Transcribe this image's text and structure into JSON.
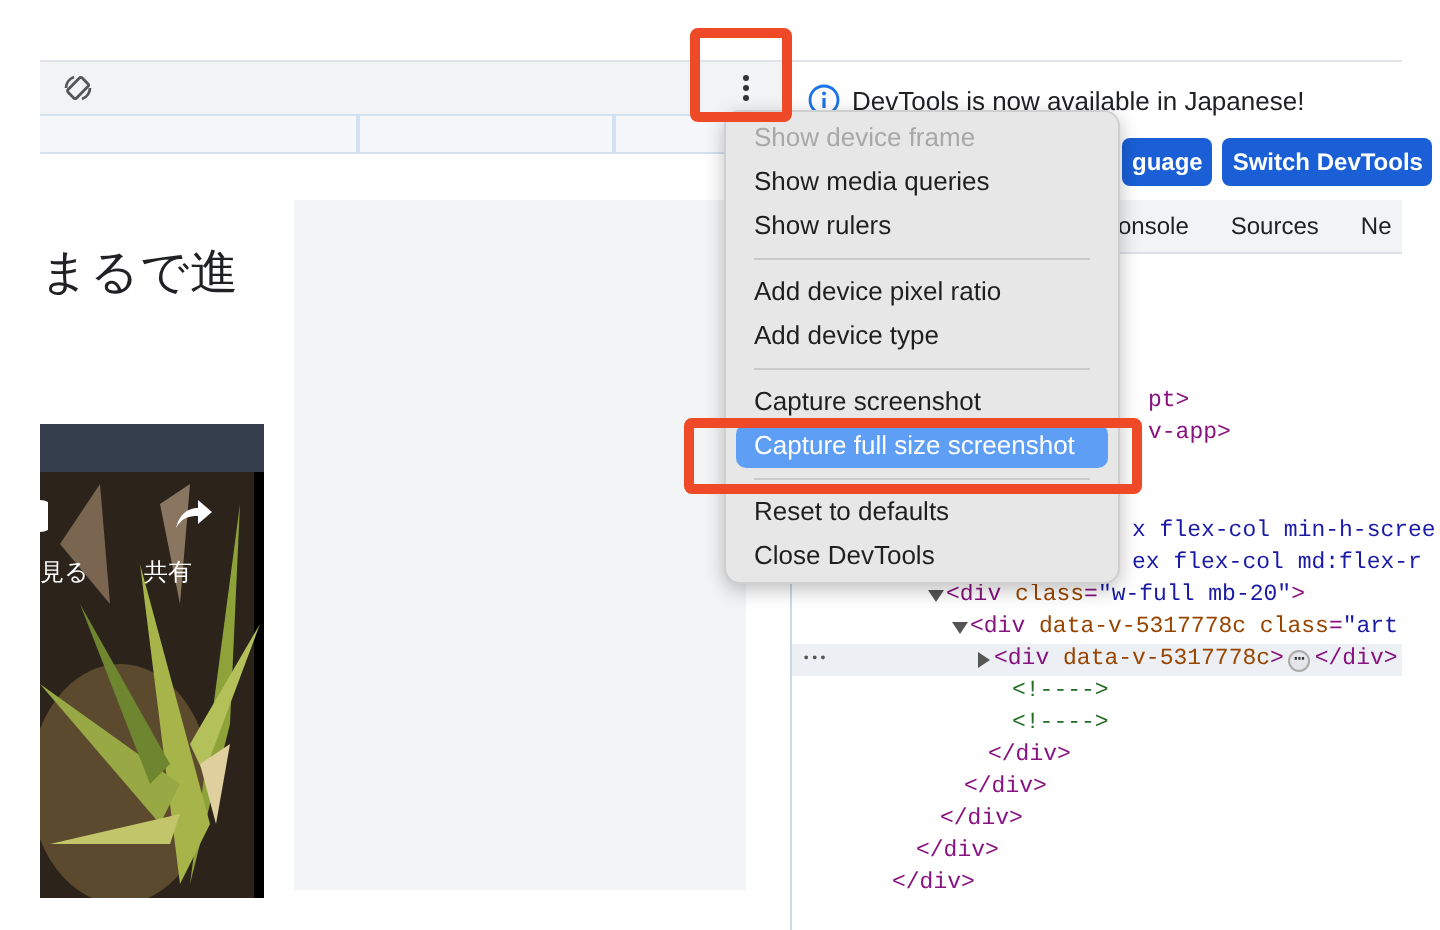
{
  "page": {
    "heading": "まるで進",
    "video": {
      "kind": "picture",
      "actions": [
        {
          "label": "見る"
        },
        {
          "label": "共有"
        }
      ]
    }
  },
  "devtools": {
    "notice": "DevTools is now available in Japanese!",
    "buttons": [
      "guage",
      "Switch DevTools"
    ],
    "tabs": [
      {
        "label": "onsole",
        "selected": false
      },
      {
        "label": "Sources",
        "selected": false
      },
      {
        "label": "Ne",
        "selected": false
      }
    ],
    "elements": [
      {
        "kind": "text",
        "highlighted": false,
        "tokens": [
          {
            "kind": "tag",
            "text": "pt>"
          }
        ]
      },
      {
        "kind": "text",
        "highlighted": false,
        "tokens": [
          {
            "kind": "tag",
            "text": "v-app>"
          }
        ]
      },
      {
        "kind": "text",
        "highlighted": false,
        "tokens": [
          {
            "kind": "value",
            "text": "x flex-col min-h-scree"
          }
        ]
      },
      {
        "kind": "text",
        "highlighted": false,
        "tokens": [
          {
            "kind": "value",
            "text": "ex flex-col md:flex-r"
          }
        ]
      },
      {
        "kind": "open",
        "highlighted": false,
        "tokens": [
          {
            "kind": "tag",
            "text": "<div"
          },
          {
            "kind": "attr",
            "text": " class"
          },
          {
            "kind": "tag",
            "text": "="
          },
          {
            "kind": "value",
            "text": "\"w-full mb-20\""
          },
          {
            "kind": "tag",
            "text": ">"
          }
        ]
      },
      {
        "kind": "open",
        "highlighted": false,
        "tokens": [
          {
            "kind": "tag",
            "text": "<div"
          },
          {
            "kind": "attr",
            "text": " data-v-5317778c"
          },
          {
            "kind": "attr",
            "text": " class"
          },
          {
            "kind": "tag",
            "text": "="
          },
          {
            "kind": "value",
            "text": "\"art"
          }
        ]
      },
      {
        "kind": "closed",
        "highlighted": true,
        "gutter": "•••",
        "tokens": [
          {
            "kind": "tag",
            "text": "<div"
          },
          {
            "kind": "attr",
            "text": " data-v-5317778c"
          },
          {
            "kind": "tag",
            "text": ">"
          },
          {
            "kind": "badge",
            "text": "⋯"
          },
          {
            "kind": "tag",
            "text": "</div>"
          }
        ]
      },
      {
        "kind": "text",
        "highlighted": false,
        "tokens": [
          {
            "kind": "comment",
            "text": "<!---->"
          }
        ]
      },
      {
        "kind": "text",
        "highlighted": false,
        "tokens": [
          {
            "kind": "comment",
            "text": "<!---->"
          }
        ]
      },
      {
        "kind": "text",
        "highlighted": false,
        "tokens": [
          {
            "kind": "tag",
            "text": "</div>"
          }
        ]
      },
      {
        "kind": "text",
        "highlighted": false,
        "tokens": [
          {
            "kind": "tag",
            "text": "</div>"
          }
        ]
      },
      {
        "kind": "text",
        "highlighted": false,
        "tokens": [
          {
            "kind": "tag",
            "text": "</div>"
          }
        ]
      },
      {
        "kind": "text",
        "highlighted": false,
        "tokens": [
          {
            "kind": "tag",
            "text": "</div>"
          }
        ]
      },
      {
        "kind": "text",
        "highlighted": false,
        "tokens": [
          {
            "kind": "tag",
            "text": "</div>"
          }
        ]
      }
    ]
  },
  "menu": [
    {
      "kind": "item",
      "label": "Show device frame",
      "disabled": true,
      "selected": false
    },
    {
      "kind": "item",
      "label": "Show media queries",
      "disabled": false,
      "selected": false
    },
    {
      "kind": "item",
      "label": "Show rulers",
      "disabled": false,
      "selected": false
    },
    {
      "kind": "separator"
    },
    {
      "kind": "item",
      "label": "Add device pixel ratio",
      "disabled": false,
      "selected": false
    },
    {
      "kind": "item",
      "label": "Add device type",
      "disabled": false,
      "selected": false
    },
    {
      "kind": "separator"
    },
    {
      "kind": "item",
      "label": "Capture screenshot",
      "disabled": false,
      "selected": false
    },
    {
      "kind": "item",
      "label": "Capture full size screenshot",
      "disabled": false,
      "selected": true
    },
    {
      "kind": "separator"
    },
    {
      "kind": "item",
      "label": "Reset to defaults",
      "disabled": false,
      "selected": false
    },
    {
      "kind": "item",
      "label": "Close DevTools",
      "disabled": false,
      "selected": false
    }
  ]
}
